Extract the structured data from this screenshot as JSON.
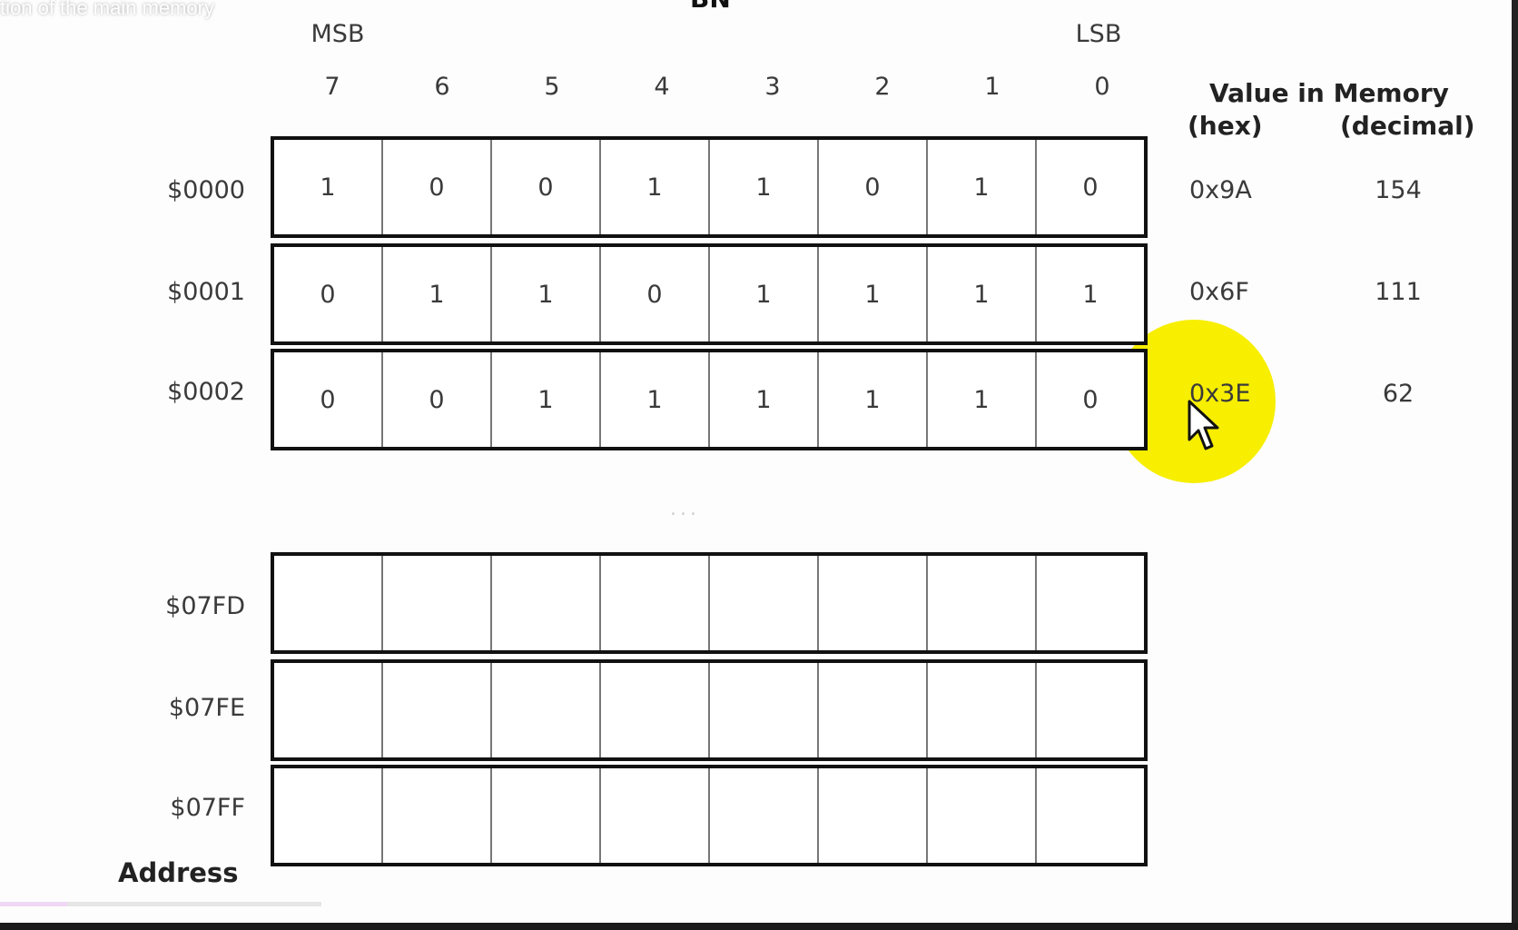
{
  "video": {
    "title_fragment": "tion of the main memory",
    "top_heading_fragment": "BN",
    "progress_fraction": 0.21
  },
  "diagram": {
    "msb_label": "MSB",
    "lsb_label": "LSB",
    "bit_indices": [
      "7",
      "6",
      "5",
      "4",
      "3",
      "2",
      "1",
      "0"
    ],
    "value_header": "Value in Memory",
    "hex_header": "(hex)",
    "decimal_header": "(decimal)",
    "address_label": "Address",
    "ellipsis": "...",
    "rows": [
      {
        "address": "$0000",
        "bits": [
          "1",
          "0",
          "0",
          "1",
          "1",
          "0",
          "1",
          "0"
        ],
        "hex": "0x9A",
        "decimal": "154"
      },
      {
        "address": "$0001",
        "bits": [
          "0",
          "1",
          "1",
          "0",
          "1",
          "1",
          "1",
          "1"
        ],
        "hex": "0x6F",
        "decimal": "111"
      },
      {
        "address": "$0002",
        "bits": [
          "0",
          "0",
          "1",
          "1",
          "1",
          "1",
          "1",
          "0"
        ],
        "hex": "0x3E",
        "decimal": "62"
      },
      {
        "address": "$07FD",
        "bits": [
          "",
          "",
          "",
          "",
          "",
          "",
          "",
          ""
        ],
        "hex": "",
        "decimal": ""
      },
      {
        "address": "$07FE",
        "bits": [
          "",
          "",
          "",
          "",
          "",
          "",
          "",
          ""
        ],
        "hex": "",
        "decimal": ""
      },
      {
        "address": "$07FF",
        "bits": [
          "",
          "",
          "",
          "",
          "",
          "",
          "",
          ""
        ],
        "hex": "",
        "decimal": ""
      }
    ]
  },
  "colors": {
    "highlight": "#f7ee00",
    "grid_border": "#111111",
    "text": "#3a3a3a"
  },
  "icons": {
    "pointer": "mouse-pointer-icon"
  }
}
